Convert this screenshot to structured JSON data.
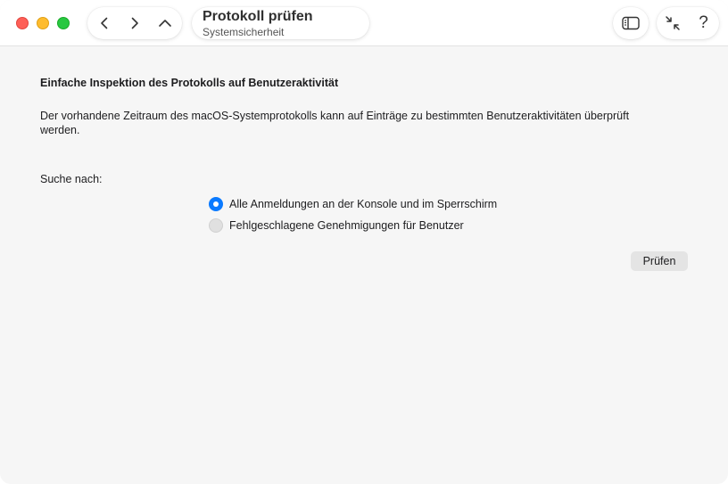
{
  "window": {
    "title": "Protokoll prüfen",
    "subtitle": "Systemsicherheit"
  },
  "toolbar": {
    "back_icon": "chevron-left-icon",
    "forward_icon": "chevron-right-icon",
    "up_icon": "chevron-up-icon",
    "sidebar_icon": "sidebar-icon",
    "collapse_icon": "arrows-collapse-icon",
    "help_label": "?"
  },
  "content": {
    "heading": "Einfache Inspektion des Protokolls auf Benutzeraktivität",
    "description": "Der vorhandene Zeitraum des macOS-Systemprotokolls kann auf Einträge zu bestimmten Benutzeraktivitäten überprüft werden.",
    "search_label": "Suche nach:",
    "options": [
      {
        "label": "Alle Anmeldungen an der Konsole und im Sperrschirm",
        "selected": true
      },
      {
        "label": "Fehlgeschlagene Genehmigungen für Benutzer",
        "selected": false
      }
    ],
    "check_button": "Prüfen"
  },
  "colors": {
    "accent": "#0a7aff",
    "close": "#fe5f57",
    "minimize": "#febc2e",
    "maximize": "#28c840"
  }
}
